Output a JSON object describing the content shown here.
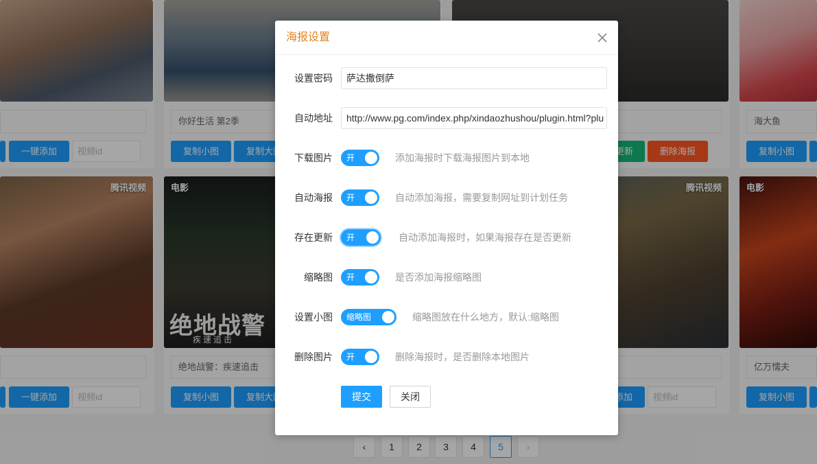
{
  "background": {
    "cards_row1": [
      {
        "title": "",
        "tag": ""
      },
      {
        "title": "你好生活 第2季",
        "tag": ""
      },
      {
        "title": "",
        "tag": ""
      },
      {
        "title": "海大鱼",
        "tag": ""
      }
    ],
    "cards_row2": [
      {
        "title": "",
        "tag": "腾讯视频"
      },
      {
        "title": "绝地战警：疾速追击",
        "tag": "电影"
      },
      {
        "title": "",
        "tag": "腾讯视频"
      },
      {
        "title": "亿万懦夫",
        "tag": "电影"
      }
    ],
    "poster_text": {
      "main": "绝地战警",
      "sub": "疾速追击"
    },
    "buttons": {
      "one_click_add": "一键添加",
      "copy_small": "复制小图",
      "copy_large": "复制大图",
      "update": "更新",
      "delete_poster": "删除海报",
      "video_id_placeholder": "视频id"
    }
  },
  "pagination": {
    "prev": "‹",
    "pages": [
      "1",
      "2",
      "3",
      "4",
      "5"
    ],
    "active": "5",
    "next": "›"
  },
  "modal": {
    "title": "海报设置",
    "fields": {
      "password": {
        "label": "设置密码",
        "value": "萨达撒倒萨"
      },
      "auto_url": {
        "label": "自动地址",
        "value": "http://www.pg.com/index.php/xindaozhushou/plugin.html?plu"
      },
      "download_image": {
        "label": "下载图片",
        "switch": "开",
        "hint": "添加海报时下载海报图片到本地"
      },
      "auto_poster": {
        "label": "自动海报",
        "switch": "开",
        "hint": "自动添加海报，需要复制网址到计划任务"
      },
      "exists_update": {
        "label": "存在更新",
        "switch": "开",
        "hint": "自动添加海报时，如果海报存在是否更新"
      },
      "thumbnail": {
        "label": "缩略图",
        "switch": "开",
        "hint": "是否添加海报缩略图"
      },
      "small_image": {
        "label": "设置小图",
        "switch": "缩略图",
        "hint": "缩略图放在什么地方，默认:缩略图"
      },
      "delete_image": {
        "label": "删除图片",
        "switch": "开",
        "hint": "删除海报时，是否删除本地图片"
      }
    },
    "submit": "提交",
    "close": "关闭"
  },
  "colors": {
    "accent": "#1e9fff",
    "title": "#e2841c",
    "green": "#16b777",
    "red": "#ff5722"
  }
}
